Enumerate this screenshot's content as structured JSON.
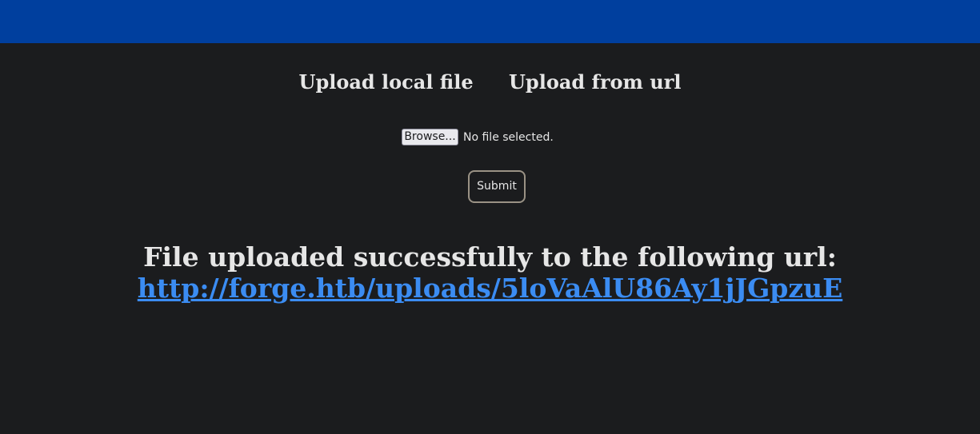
{
  "header": {
    "bar_color": "#003f9e"
  },
  "tabs": [
    {
      "label": "Upload local file"
    },
    {
      "label": "Upload from url"
    }
  ],
  "file_input": {
    "browse_label": "Browse...",
    "status": "No file selected."
  },
  "submit": {
    "label": "Submit"
  },
  "result": {
    "message": "File uploaded successfully to the following url:",
    "url": "http://forge.htb/uploads/5loVaAlU86Ay1jJGpzuE"
  }
}
